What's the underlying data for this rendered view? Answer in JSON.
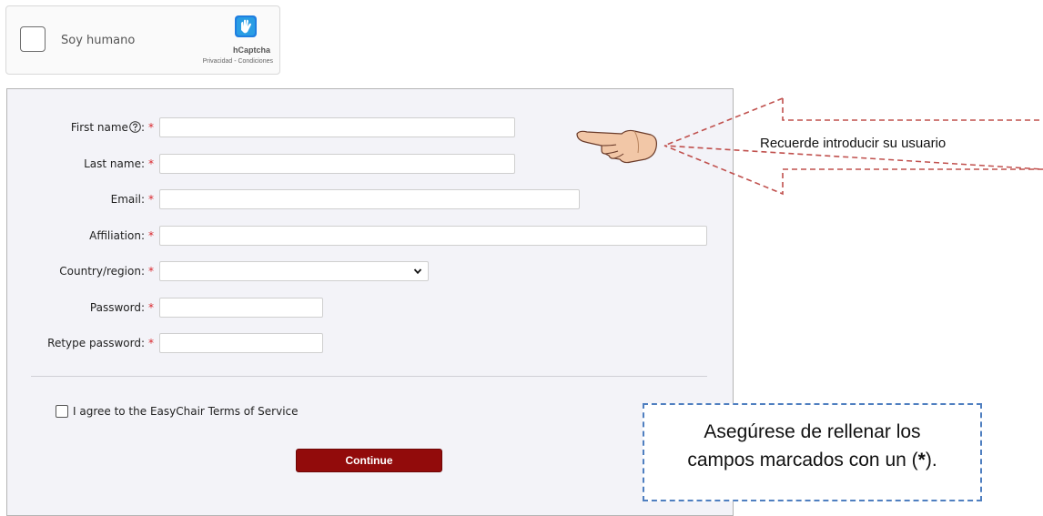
{
  "captcha": {
    "label": "Soy humano",
    "brand": "hCaptcha",
    "legal": "Privacidad - Condiciones",
    "logo_icon": "hcaptcha-hand-logo",
    "logo_color": "#1f7ee0"
  },
  "form": {
    "required_mark": "*",
    "fields": {
      "first_name": {
        "label": "First name",
        "suffix": ":",
        "value": ""
      },
      "last_name": {
        "label": "Last name:",
        "value": ""
      },
      "email": {
        "label": "Email:",
        "value": ""
      },
      "affiliation": {
        "label": "Affiliation:",
        "value": ""
      },
      "country": {
        "label": "Country/region:",
        "value": ""
      },
      "password": {
        "label": "Password:",
        "value": ""
      },
      "retype_password": {
        "label": "Retype password:",
        "value": ""
      }
    },
    "agree_text": "I agree to the EasyChair Terms of Service",
    "agree_checked": false,
    "continue_label": "Continue",
    "continue_color": "#920b0b",
    "required_color": "#d9262c"
  },
  "annotations": {
    "callout_text": "Recuerde introducir su usuario",
    "note_line1": "Asegúrese de rellenar los",
    "note_line2_pre": "campos marcados con un (",
    "note_line2_star": "*",
    "note_line2_post": ").",
    "callout_border_color": "#c0504d",
    "note_border_color": "#4f7fc0"
  }
}
